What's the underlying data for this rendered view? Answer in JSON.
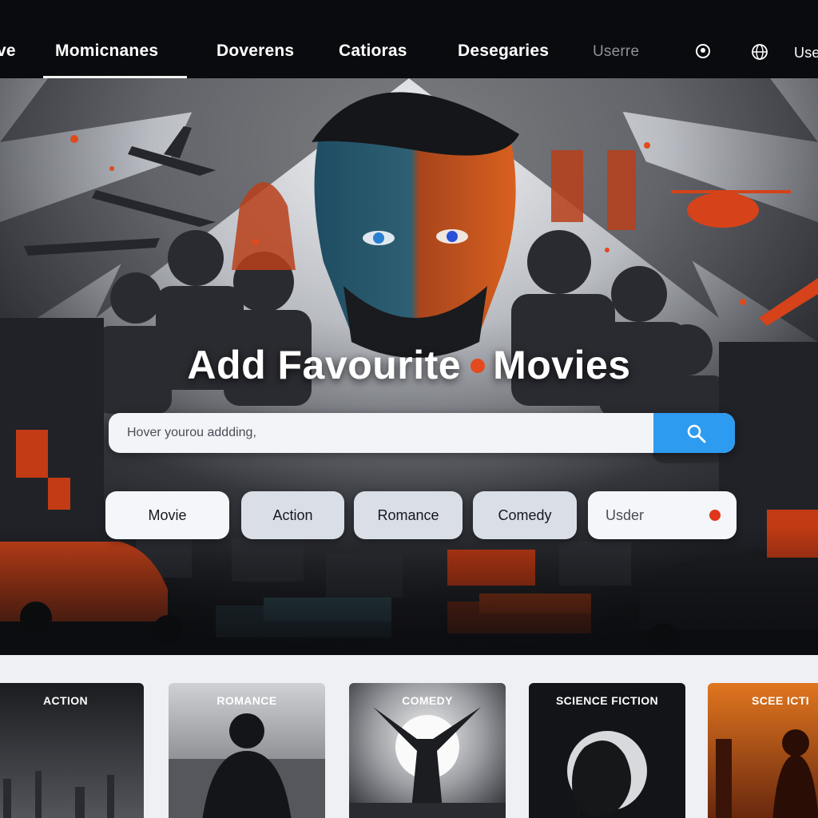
{
  "nav": {
    "items": [
      {
        "label": "ve"
      },
      {
        "label": "Momicnanes"
      },
      {
        "label": "Doverens"
      },
      {
        "label": "Catioras"
      },
      {
        "label": "Desegaries"
      },
      {
        "label": "Userre"
      },
      {
        "label": "Use"
      }
    ],
    "icons": [
      "user-circle-icon",
      "globe-icon"
    ]
  },
  "hero": {
    "title_left": "Add Favourite",
    "title_right": "Movies"
  },
  "search": {
    "placeholder": "Hover yourou addding,",
    "button_icon": "search-icon"
  },
  "chips": [
    "Movie",
    "Action",
    "Romance",
    "Comedy",
    "Usder"
  ],
  "categories": [
    "ACTION",
    "ROMANCE",
    "COMEDY",
    "SCIENCE FICTION",
    "SCEE ICTI"
  ],
  "colors": {
    "accent_blue": "#2d9bf0",
    "accent_orange": "#e0361b",
    "nav_background": "#0a0b0e"
  }
}
